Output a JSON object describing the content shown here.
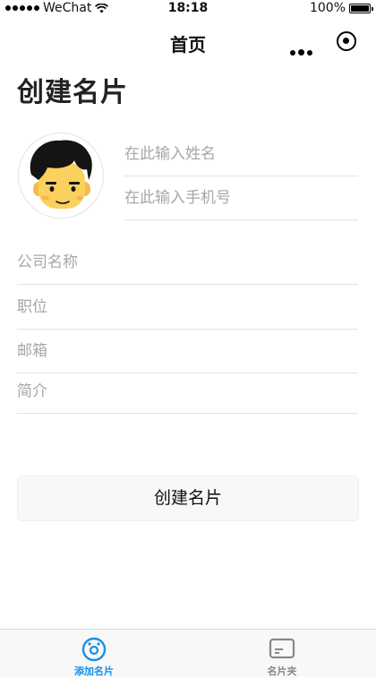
{
  "status_bar": {
    "carrier": "WeChat",
    "time": "18:18",
    "battery": "100%"
  },
  "nav": {
    "title": "首页"
  },
  "page": {
    "title": "创建名片"
  },
  "form": {
    "name_placeholder": "在此输入姓名",
    "phone_placeholder": "在此输入手机号",
    "company_placeholder": "公司名称",
    "position_placeholder": "职位",
    "email_placeholder": "邮箱",
    "intro_placeholder": "简介",
    "submit_label": "创建名片"
  },
  "tab_bar": {
    "tabs": [
      {
        "label": "添加名片",
        "icon": "add-card-icon",
        "color": "#1a8ee6",
        "active": true
      },
      {
        "label": "名片夹",
        "icon": "card-holder-icon",
        "color": "#888888",
        "active": false
      }
    ]
  }
}
